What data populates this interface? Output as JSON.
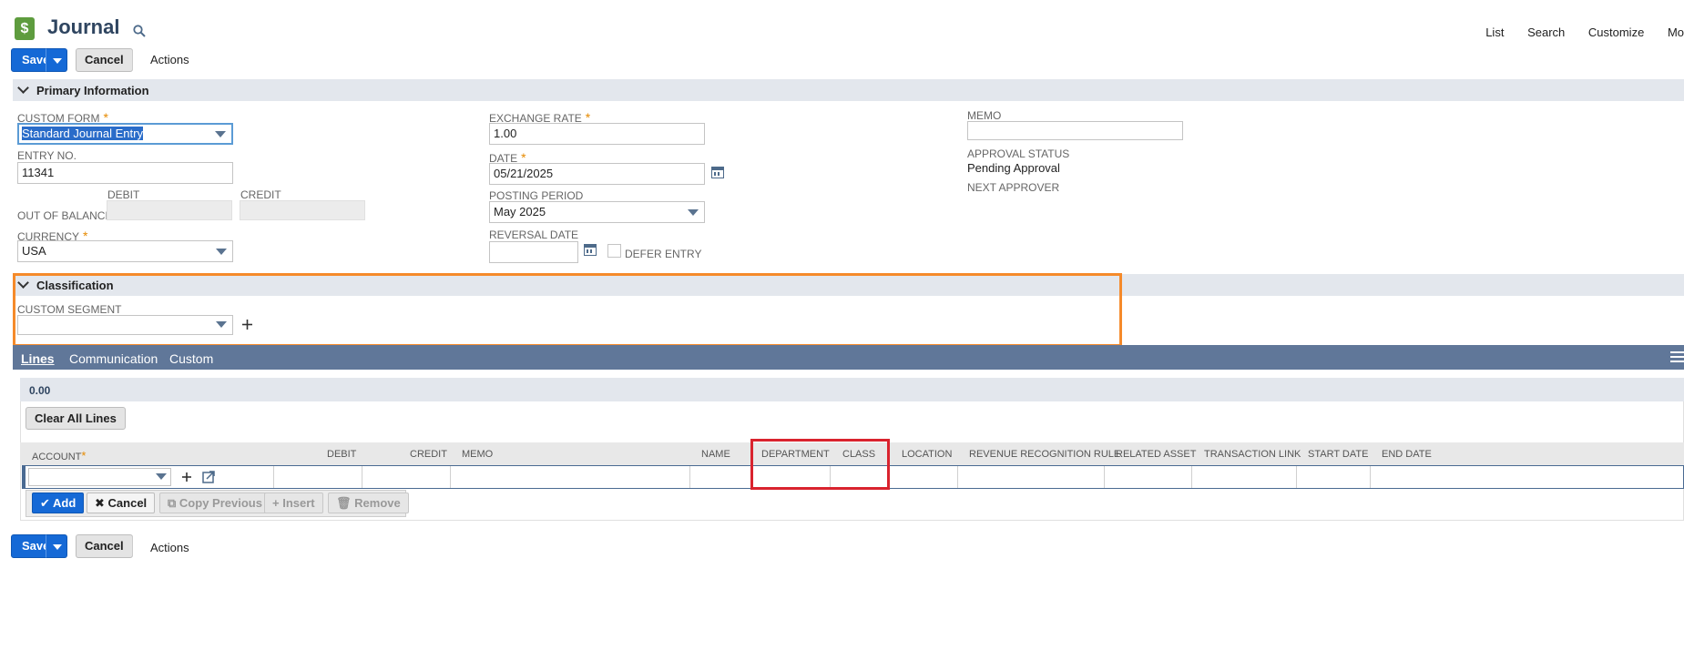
{
  "header": {
    "title": "Journal",
    "logo_glyph": "$",
    "nav_links": [
      "List",
      "Search",
      "Customize",
      "Mo"
    ]
  },
  "toolbar": {
    "save_label": "Save",
    "cancel_label": "Cancel",
    "actions_label": "Actions"
  },
  "primary_section": {
    "title": "Primary Information",
    "custom_form": {
      "label": "CUSTOM FORM",
      "value": "Standard Journal Entry"
    },
    "entry_no": {
      "label": "ENTRY NO.",
      "value": "11341"
    },
    "debit_label": "DEBIT",
    "credit_label": "CREDIT",
    "out_of_balance_label": "OUT OF BALANCE BY",
    "currency": {
      "label": "CURRENCY",
      "value": "USA"
    },
    "exchange_rate": {
      "label": "EXCHANGE RATE",
      "value": "1.00"
    },
    "date": {
      "label": "DATE",
      "value": "05/21/2025"
    },
    "posting_period": {
      "label": "POSTING PERIOD",
      "value": "May 2025"
    },
    "reversal_date": {
      "label": "REVERSAL DATE",
      "value": ""
    },
    "defer_entry_label": "DEFER ENTRY",
    "memo": {
      "label": "MEMO",
      "value": ""
    },
    "approval_status": {
      "label": "APPROVAL STATUS",
      "value": "Pending Approval"
    },
    "next_approver_label": "NEXT APPROVER"
  },
  "classification_section": {
    "title": "Classification",
    "custom_segment_label": "CUSTOM SEGMENT",
    "custom_segment_value": ""
  },
  "subtabs": [
    {
      "label": "Lines",
      "active": true
    },
    {
      "label": "Communication",
      "active": false
    },
    {
      "label": "Custom",
      "active": false
    }
  ],
  "lines": {
    "total": "0.00",
    "clear_all_label": "Clear All Lines",
    "columns": [
      "ACCOUNT",
      "DEBIT",
      "CREDIT",
      "MEMO",
      "NAME",
      "DEPARTMENT",
      "CLASS",
      "LOCATION",
      "REVENUE RECOGNITION RULE",
      "RELATED ASSET",
      "TRANSACTION LINK",
      "START DATE",
      "END DATE"
    ],
    "row_buttons": {
      "add": "Add",
      "cancel": "Cancel",
      "copy_previous": "Copy Previous",
      "insert": "Insert",
      "remove": "Remove"
    }
  },
  "footer_toolbar": {
    "save_label": "Save",
    "cancel_label": "Cancel",
    "actions_label": "Actions"
  },
  "colors": {
    "primary_blue": "#1569d6",
    "subtab_bar": "#607799",
    "section_bar": "#e3e7ed",
    "highlight_orange": "#f58a2a",
    "highlight_red": "#d9232e"
  }
}
